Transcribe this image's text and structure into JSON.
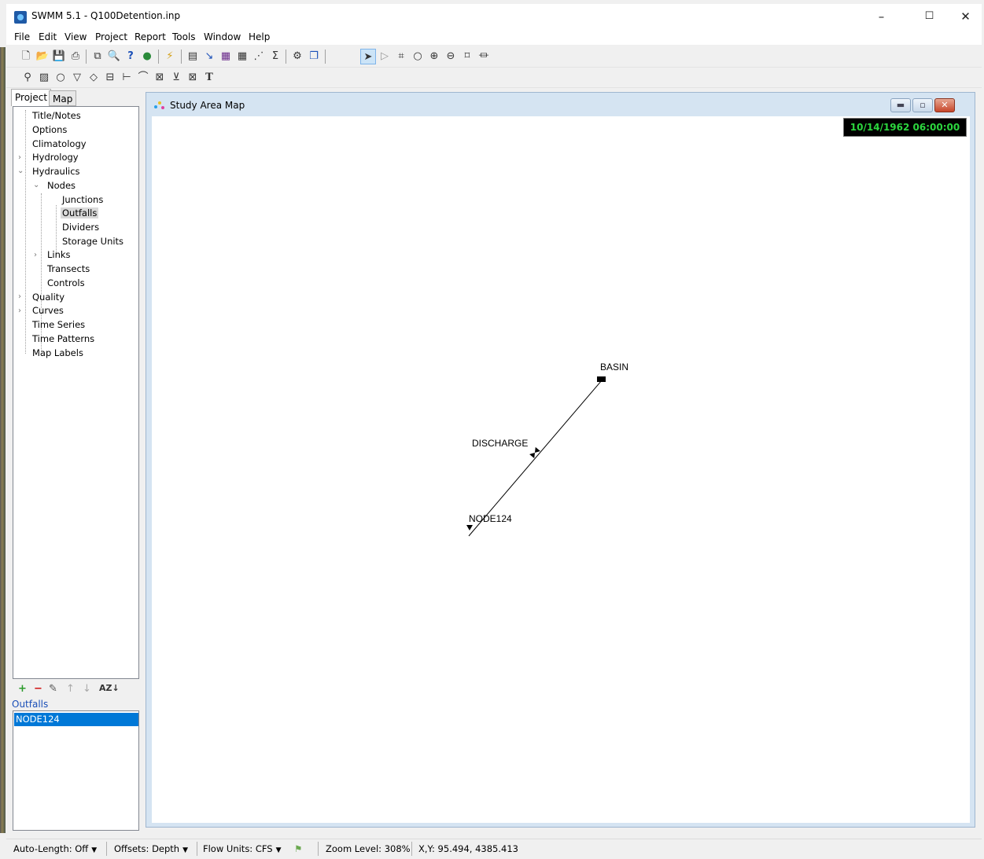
{
  "window": {
    "title": "SWMM 5.1 - Q100Detention.inp",
    "minimize": "–",
    "maximize": "☐",
    "close": "✕"
  },
  "menu": [
    "File",
    "Edit",
    "View",
    "Project",
    "Report",
    "Tools",
    "Window",
    "Help"
  ],
  "toolbar1": [
    "new-icon",
    "open-icon",
    "save-icon",
    "print-icon",
    "copy-icon",
    "find-icon",
    "query-icon",
    "overview-map-icon",
    "run-icon",
    "status-report-icon",
    "profile-plot-icon",
    "time-series-plot-icon",
    "table-icon",
    "scatter-plot-icon",
    "statistics-icon",
    "options-icon",
    "arrange-windows-icon",
    "select-object-icon",
    "select-vertex-icon",
    "select-region-icon",
    "select-all-icon",
    "zoom-in-icon",
    "zoom-out-icon",
    "full-extent-icon",
    "measure-icon"
  ],
  "toolbar2": [
    "rain-gage-icon",
    "subcatchment-icon",
    "junction-icon",
    "outfall-icon",
    "divider-icon",
    "storage-unit-icon",
    "conduit-icon",
    "pump-icon",
    "orifice-icon",
    "weir-icon",
    "outlet-icon",
    "label-icon"
  ],
  "tabs": {
    "project": "Project",
    "map": "Map"
  },
  "tree": [
    {
      "label": "Title/Notes"
    },
    {
      "label": "Options"
    },
    {
      "label": "Climatology"
    },
    {
      "label": "Hydrology"
    },
    {
      "label": "Hydraulics"
    },
    {
      "label": "Nodes"
    },
    {
      "label": "Junctions"
    },
    {
      "label": "Outfalls"
    },
    {
      "label": "Dividers"
    },
    {
      "label": "Storage Units"
    },
    {
      "label": "Links"
    },
    {
      "label": "Transects"
    },
    {
      "label": "Controls"
    },
    {
      "label": "Quality"
    },
    {
      "label": "Curves"
    },
    {
      "label": "Time Series"
    },
    {
      "label": "Time Patterns"
    },
    {
      "label": "Map Labels"
    }
  ],
  "object_list": {
    "category": "Outfalls",
    "items": [
      "NODE124"
    ]
  },
  "map_window": {
    "title": "Study Area Map",
    "clock": "10/14/1962 06:00:00",
    "nodes": {
      "basin": "BASIN",
      "discharge": "DISCHARGE",
      "node124": "NODE124"
    }
  },
  "status": {
    "auto_length": "Auto-Length: Off",
    "offsets": "Offsets: Depth",
    "flow_units": "Flow Units: CFS",
    "zoom": "Zoom Level: 308%",
    "xy": "X,Y: 95.494, 4385.413"
  }
}
